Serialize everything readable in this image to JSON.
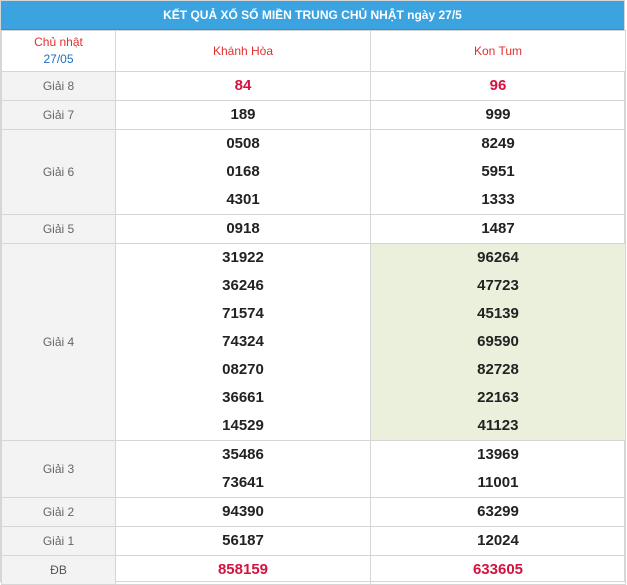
{
  "title": "KẾT QUẢ XỔ SỐ MIỀN TRUNG CHỦ NHẬT ngày 27/5",
  "header": {
    "day_label": "Chủ nhật",
    "day_date": "27/05",
    "provinces": [
      "Khánh Hòa",
      "Kon Tum"
    ]
  },
  "prizes": {
    "g8": {
      "label": "Giải 8",
      "khanh_hoa": [
        "84"
      ],
      "kon_tum": [
        "96"
      ]
    },
    "g7": {
      "label": "Giải 7",
      "khanh_hoa": [
        "189"
      ],
      "kon_tum": [
        "999"
      ]
    },
    "g6": {
      "label": "Giải 6",
      "khanh_hoa": [
        "0508",
        "0168",
        "4301"
      ],
      "kon_tum": [
        "8249",
        "5951",
        "1333"
      ]
    },
    "g5": {
      "label": "Giải 5",
      "khanh_hoa": [
        "0918"
      ],
      "kon_tum": [
        "1487"
      ]
    },
    "g4": {
      "label": "Giải 4",
      "khanh_hoa": [
        "31922",
        "36246",
        "71574",
        "74324",
        "08270",
        "36661",
        "14529"
      ],
      "kon_tum": [
        "96264",
        "47723",
        "45139",
        "69590",
        "82728",
        "22163",
        "41123"
      ]
    },
    "g3": {
      "label": "Giải 3",
      "khanh_hoa": [
        "35486",
        "73641"
      ],
      "kon_tum": [
        "13969",
        "11001"
      ]
    },
    "g2": {
      "label": "Giải 2",
      "khanh_hoa": [
        "94390"
      ],
      "kon_tum": [
        "63299"
      ]
    },
    "g1": {
      "label": "Giải 1",
      "khanh_hoa": [
        "56187"
      ],
      "kon_tum": [
        "12024"
      ]
    },
    "db": {
      "label": "ĐB",
      "khanh_hoa": [
        "858159"
      ],
      "kon_tum": [
        "633605"
      ]
    }
  },
  "colors": {
    "title_bg": "#3aa3e0",
    "accent_red": "#d4123f",
    "highlight_bg": "#eaf0dc",
    "date_blue": "#1a6fc2"
  }
}
